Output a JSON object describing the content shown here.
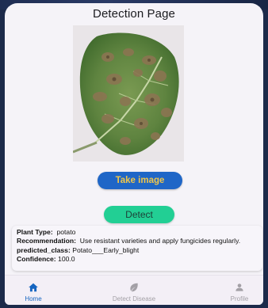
{
  "page": {
    "title": "Detection Page"
  },
  "buttons": {
    "take_image": "Take image",
    "detect": "Detect"
  },
  "result": {
    "plant_type_label": "Plant Type:",
    "plant_type_value": "potato",
    "recommendation_label": "Recommendation:",
    "recommendation_value": "Use resistant varieties and apply fungicides regularly.",
    "predicted_class_label": "predicted_class:",
    "predicted_class_value": "Potato___Early_blight",
    "confidence_label": "Confidence:",
    "confidence_value": "100.0"
  },
  "nav": {
    "items": [
      {
        "label": "Home",
        "icon": "home-icon",
        "active": true
      },
      {
        "label": "Detect Disease",
        "icon": "leaf-icon",
        "active": false
      },
      {
        "label": "Profile",
        "icon": "person-icon",
        "active": false
      }
    ]
  },
  "colors": {
    "take_button": "#1f66c7",
    "take_button_text": "#f0c64a",
    "detect_button": "#22cf94",
    "active_nav": "#1565c0",
    "inactive_nav": "#a3a0a6"
  }
}
